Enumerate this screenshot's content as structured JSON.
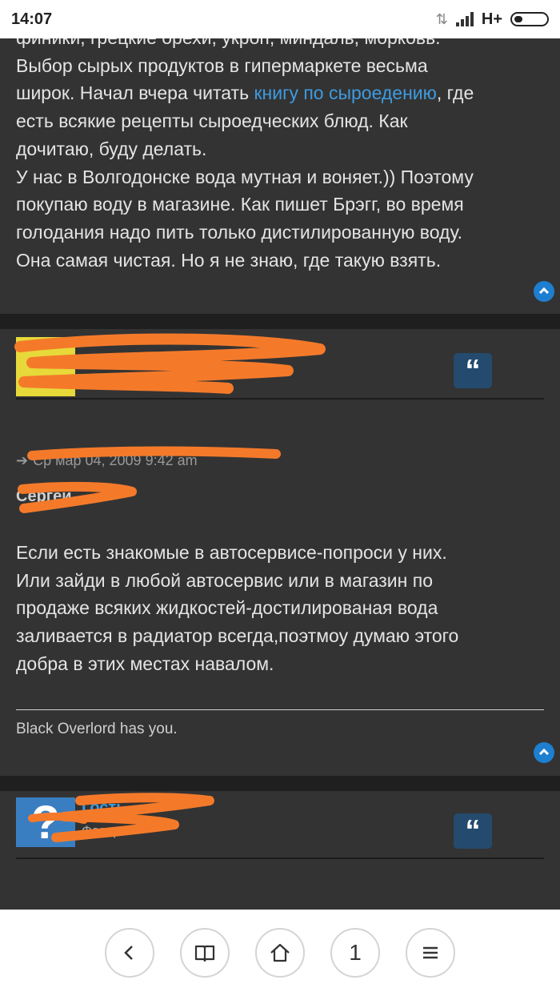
{
  "status_bar": {
    "time": "14:07",
    "network": "H+"
  },
  "posts": [
    {
      "body_lines": [
        "финики, грецкие орехи, укроп, миндаль, морковь.",
        "Выбор сырых продуктов в гипермаркете весьма",
        "широк. Начал вчера читать "
      ],
      "link_text": "книгу по сыроедению",
      "after_link": ", где",
      "body_lines_2": [
        "есть всякие рецепты сыроедческих блюд. Как",
        "дочитаю, буду делать.",
        "У нас в Волгодонске вода мутная и воняет.)) Поэтому",
        "покупаю воду в магазине. Как пишет Брэгг, во время",
        "голодания надо пить только дистилированную воду.",
        "Она самая чистая. Но я не знаю, где такую взять."
      ]
    },
    {
      "quote_meta": "Ср мар 04, 2009 9:42 am",
      "quote_author": "Сергей",
      "body_lines": [
        "Если есть знакомые в автосервисе-попроси у них.",
        "Или зайди в любой автосервис или в магазин по",
        "продаже всяких жидкостей-достилированая вода",
        "заливается в радиатор всегда,поэтмоу думаю этого",
        "добра в этих местах навалом."
      ],
      "signature": "Black Overlord has you."
    },
    {
      "avatar_glyph": "?",
      "author_name": "Гость",
      "author_rank": "Фазер"
    }
  ],
  "quote_glyph": "“",
  "navbar": {
    "tabs_count": "1"
  },
  "colors": {
    "link": "#3d9be0",
    "quote_button": "#244b6e",
    "scribble": "#f47a2a"
  }
}
